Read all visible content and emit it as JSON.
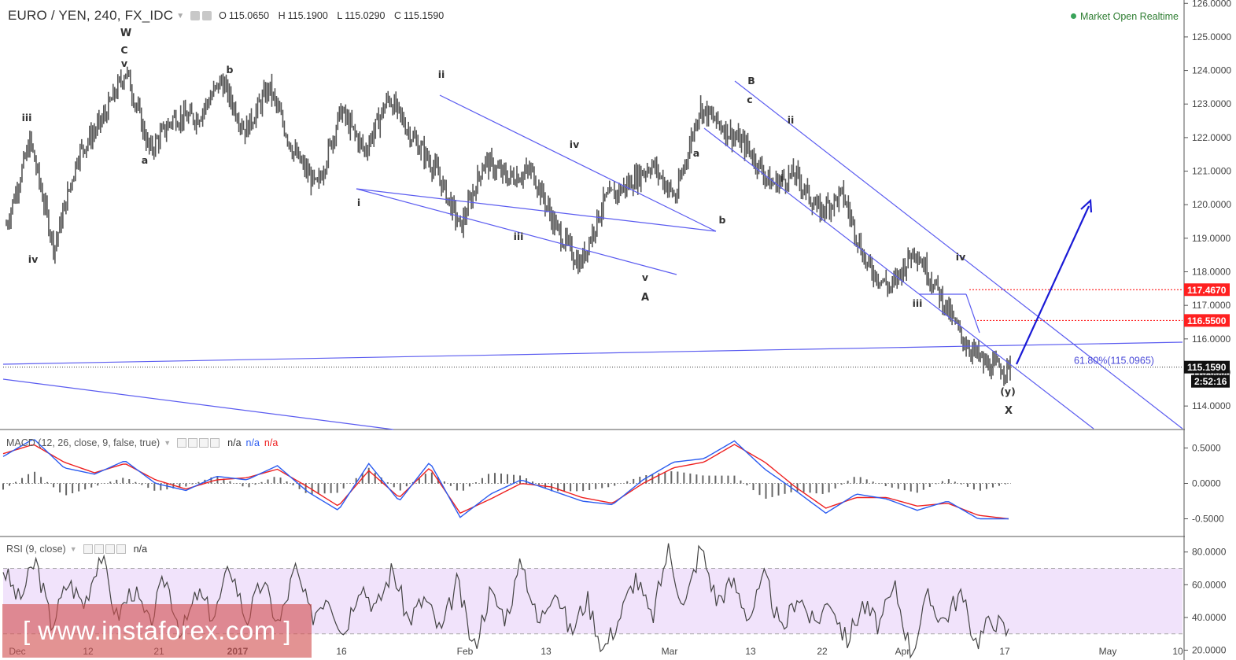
{
  "header": {
    "symbol": "EURO / YEN, 240, FX_IDC",
    "open_label": "O",
    "open": "115.0650",
    "high_label": "H",
    "high": "115.1900",
    "low_label": "L",
    "low": "115.0290",
    "close_label": "C",
    "close": "115.1590"
  },
  "market_status": "Market Open Realtime",
  "macd_pane": {
    "title": "MACD (12, 26, close, 9, false, true)",
    "values": [
      "n/a",
      "n/a",
      "n/a"
    ]
  },
  "rsi_pane": {
    "title": "RSI (9, close)",
    "values": [
      "n/a"
    ]
  },
  "watermark": "[ www.instaforex.com ]",
  "colors": {
    "candle": "#555555",
    "trendline": "#5b5cf0",
    "arrow": "#1a1ad6",
    "level": "#ff0000",
    "macd_line": "#2a5bf0",
    "signal_line": "#ee2020",
    "histogram": "#666666",
    "rsi_line": "#444444",
    "rsi_band": "#f1e3fb"
  },
  "chart_data": {
    "type": "bar",
    "instrument": "EURO / YEN",
    "timeframe": "240",
    "x_axis_labels": [
      "Dec",
      "12",
      "21",
      "2017",
      "16",
      "Feb",
      "13",
      "Mar",
      "13",
      "22",
      "Apr",
      "17",
      "May",
      "10"
    ],
    "price_axis": {
      "ticks": [
        "126.0000",
        "125.0000",
        "124.0000",
        "123.0000",
        "122.0000",
        "121.0000",
        "120.0000",
        "119.0000",
        "118.0000",
        "117.0000",
        "116.0000",
        "115.0000",
        "114.0000"
      ],
      "range": [
        113.3,
        126.1
      ]
    },
    "approx_closes": [
      119.4,
      121.9,
      118.7,
      121.5,
      122.5,
      124.0,
      121.6,
      122.6,
      122.6,
      123.7,
      122.2,
      123.5,
      121.6,
      120.5,
      122.8,
      121.6,
      123.2,
      122.0,
      121.0,
      119.3,
      121.3,
      120.8,
      121.0,
      119.3,
      118.2,
      120.1,
      120.6,
      121.2,
      120.2,
      122.9,
      122.3,
      121.7,
      120.6,
      120.9,
      119.8,
      120.3,
      118.2,
      117.5,
      118.7,
      117.4,
      116.0,
      115.2,
      115.1
    ],
    "price_labels": [
      {
        "text": "117.4670",
        "style": "red-box"
      },
      {
        "text": "116.5500",
        "style": "red-box"
      },
      {
        "text": "115.1590",
        "style": "black-box"
      },
      {
        "text": "2:52:16",
        "style": "black-box"
      }
    ],
    "fib_label": "61.80%(115.0965)",
    "wave_labels": [
      "W",
      "C",
      "v",
      "iii",
      "iv",
      "a",
      "b",
      "i",
      "ii",
      "iii",
      "iv",
      "v",
      "A",
      "a",
      "b",
      "B",
      "c",
      "ii",
      "i",
      "iii",
      "iv",
      "(y)",
      "X"
    ],
    "macd": {
      "ticks": [
        "0.5000",
        "0.0000",
        "-0.5000"
      ],
      "range": [
        -0.75,
        0.75
      ],
      "approx_macd": [
        0.38,
        0.63,
        0.22,
        0.13,
        0.32,
        0.0,
        -0.1,
        0.1,
        0.05,
        0.25,
        -0.12,
        -0.38,
        0.28,
        -0.25,
        0.3,
        -0.48,
        -0.15,
        0.05,
        -0.1,
        -0.25,
        -0.3,
        0.05,
        0.3,
        0.35,
        0.6,
        0.2,
        -0.1,
        -0.42,
        -0.15,
        -0.22,
        -0.38,
        -0.25,
        -0.5,
        -0.5
      ],
      "approx_signal": [
        0.42,
        0.55,
        0.3,
        0.15,
        0.28,
        0.05,
        -0.08,
        0.05,
        0.08,
        0.2,
        -0.05,
        -0.32,
        0.18,
        -0.2,
        0.22,
        -0.42,
        -0.22,
        0.0,
        -0.05,
        -0.2,
        -0.28,
        0.0,
        0.22,
        0.3,
        0.55,
        0.3,
        -0.05,
        -0.35,
        -0.2,
        -0.2,
        -0.32,
        -0.28,
        -0.45,
        -0.5
      ]
    },
    "rsi": {
      "ticks": [
        "80.0000",
        "60.0000",
        "40.0000",
        "20.0000"
      ],
      "range": [
        14,
        89
      ],
      "band": [
        30,
        70
      ],
      "approx_values": [
        70,
        50,
        75,
        35,
        62,
        48,
        80,
        40,
        58,
        35,
        65,
        30,
        55,
        40,
        72,
        38,
        62,
        35,
        70,
        40,
        55,
        30,
        62,
        45,
        70,
        38,
        52,
        30,
        62,
        20,
        55,
        40,
        75,
        35,
        60,
        30,
        52,
        20,
        40,
        65,
        38,
        82,
        45,
        84,
        50,
        62,
        40,
        65,
        30,
        55,
        35,
        52,
        25,
        48,
        35,
        58,
        18,
        52,
        38,
        55,
        25,
        40,
        30
      ]
    }
  }
}
